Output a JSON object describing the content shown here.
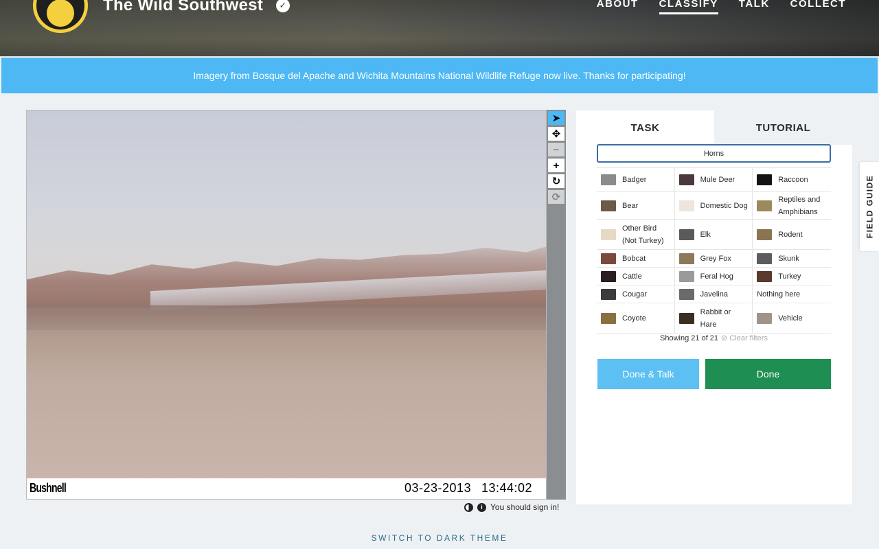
{
  "header": {
    "title": "The Wild Southwest",
    "nav": [
      "ABOUT",
      "CLASSIFY",
      "TALK",
      "COLLECT"
    ],
    "active_nav": "CLASSIFY"
  },
  "banner": {
    "text": "Imagery from Bosque del Apache and Wichita Mountains National Wildlife Refuge now live. Thanks for participating!"
  },
  "camera": {
    "brand": "Bushnell",
    "date": "03-23-2013",
    "time": "13:44:02"
  },
  "viewer_meta": {
    "sign_in": "You should sign in!"
  },
  "panel": {
    "tabs": [
      "TASK",
      "TUTORIAL"
    ],
    "filter_label": "Horns",
    "choices": [
      [
        "Badger",
        "Mule Deer",
        "Raccoon"
      ],
      [
        "Bear",
        "Domestic Dog",
        "Reptiles and Amphibians"
      ],
      [
        "Other Bird (Not Turkey)",
        "Elk",
        "Rodent"
      ],
      [
        "Bobcat",
        "Grey Fox",
        "Skunk"
      ],
      [
        "Cattle",
        "Feral Hog",
        "Turkey"
      ],
      [
        "Cougar",
        "Javelina",
        "Nothing here"
      ],
      [
        "Coyote",
        "Rabbit or Hare",
        "Vehicle"
      ]
    ],
    "showing": "Showing 21 of 21",
    "clear_filters": "Clear filters",
    "done_talk": "Done & Talk",
    "done": "Done"
  },
  "field_guide": "FIELD GUIDE",
  "theme_link": "SWITCH TO DARK THEME",
  "colors": {
    "banner": "#4db8f4",
    "done": "#1e8e52",
    "done_talk": "#5cc0f2",
    "logo_ring": "#f4d03f"
  }
}
